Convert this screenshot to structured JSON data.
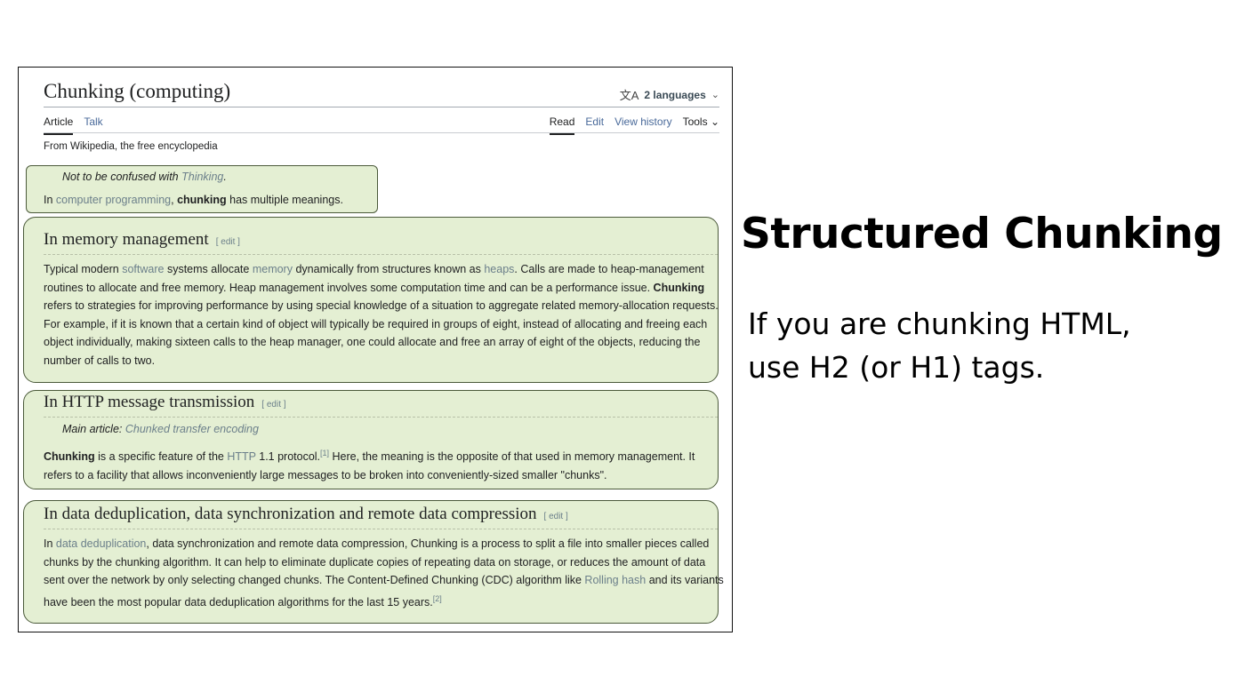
{
  "article": {
    "title": "Chunking (computing)",
    "languages": "2 languages",
    "tabs_left": [
      "Article",
      "Talk"
    ],
    "tabs_right": [
      "Read",
      "Edit",
      "View history",
      "Tools"
    ],
    "from": "From Wikipedia, the free encyclopedia",
    "hatnote": {
      "prefix": "Not to be confused with ",
      "link": "Thinking",
      "suffix": "."
    },
    "intro": {
      "p1": "In ",
      "link": "computer programming",
      "p2": ", ",
      "bold": "chunking",
      "p3": " has multiple meanings."
    },
    "edit_label": "[ edit ]"
  },
  "sections": {
    "memory": {
      "heading": "In memory management",
      "t1": "Typical modern ",
      "l1": "software",
      "t2": " systems allocate ",
      "l2": "memory",
      "t3": " dynamically from structures known as ",
      "l3": "heaps",
      "t4": ". Calls are made to heap-management routines to allocate and free memory. Heap management involves some computation time and can be a performance issue. ",
      "bold": "Chunking",
      "t5": " refers to strategies for improving performance by using special knowledge of a situation to aggregate related memory-allocation requests. For example, if it is known that a certain kind of object will typically be required in groups of eight, instead of allocating and freeing each object individually, making sixteen calls to the heap manager, one could allocate and free an array of eight of the objects, reducing the number of calls to two."
    },
    "http": {
      "heading": "In HTTP message transmission",
      "main_prefix": "Main article: ",
      "main_link": "Chunked transfer encoding",
      "bold": "Chunking",
      "t1": " is a specific feature of the ",
      "l1": "HTTP",
      "t2": " 1.1 protocol.",
      "ref": "[1]",
      "t3": " Here, the meaning is the opposite of that used in memory management. It refers to a facility that allows inconveniently large messages to be broken into conveniently-sized smaller \"chunks\"."
    },
    "dedup": {
      "heading": "In data deduplication, data synchronization and remote data compression",
      "t1": "In ",
      "l1": "data deduplication",
      "t2": ", data synchronization and remote data compression, Chunking is a process to split a file into smaller pieces called chunks by the chunking algorithm. It can help to eliminate duplicate copies of repeating data on storage, or reduces the amount of data sent over the network by only selecting changed chunks. The Content-Defined Chunking (CDC) algorithm like ",
      "l2": "Rolling hash",
      "t3": " and its variants have been the most popular data deduplication algorithms for the last 15 years.",
      "ref": "[2]"
    }
  },
  "slide": {
    "title": "Structured Chunking",
    "line1": "If you are chunking HTML,",
    "line2": "use H2 (or H1) tags."
  },
  "colors": {
    "highlight": "#e4efd3",
    "border": "#4b5a3a"
  }
}
